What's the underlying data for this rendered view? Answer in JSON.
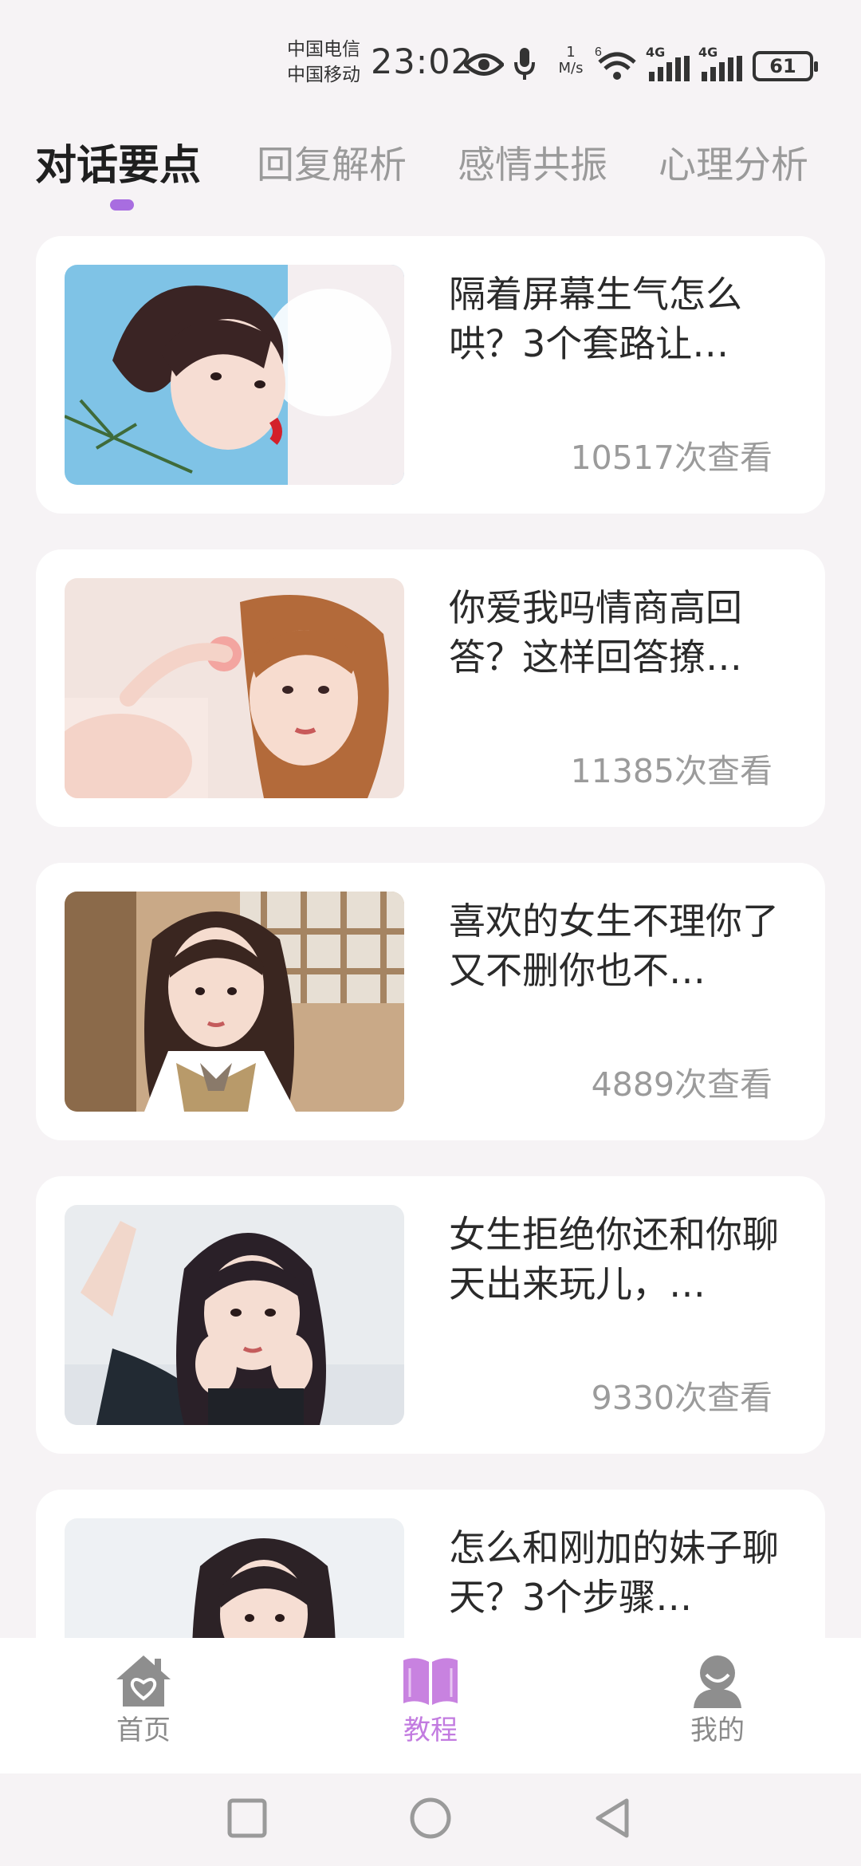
{
  "status_bar": {
    "carrier_1": "中国电信",
    "carrier_2": "中国移动",
    "time": "23:02",
    "speed_value": "1",
    "speed_unit": "M/s",
    "wifi_badge": "6",
    "network_1": "4G",
    "network_2": "4G",
    "battery": "61",
    "icons": [
      "eye-icon",
      "microphone-icon",
      "wifi-icon",
      "signal-icon",
      "signal-icon",
      "battery-icon"
    ]
  },
  "tabs": [
    {
      "label": "对话要点",
      "active": true
    },
    {
      "label": "回复解析",
      "active": false
    },
    {
      "label": "感情共振",
      "active": false
    },
    {
      "label": "心理分析",
      "active": false
    }
  ],
  "articles": [
    {
      "title": "隔着屏幕生气怎么哄？3个套路让…",
      "views": "10517次查看"
    },
    {
      "title": "你爱我吗情商高回答？这样回答撩…",
      "views": "11385次查看"
    },
    {
      "title": "喜欢的女生不理你了又不删你也不…",
      "views": "4889次查看"
    },
    {
      "title": "女生拒绝你还和你聊天出来玩儿，…",
      "views": "9330次查看"
    },
    {
      "title": "怎么和刚加的妹子聊天？3个步骤…",
      "views": ""
    }
  ],
  "bottom_nav": [
    {
      "label": "首页",
      "icon": "home-heart-icon",
      "active": false
    },
    {
      "label": "教程",
      "icon": "open-book-icon",
      "active": true
    },
    {
      "label": "我的",
      "icon": "user-icon",
      "active": false
    }
  ],
  "colors": {
    "accent": "#a86de0",
    "active_nav": "#c27be0",
    "background": "#f6f3f5",
    "card": "#ffffff"
  }
}
